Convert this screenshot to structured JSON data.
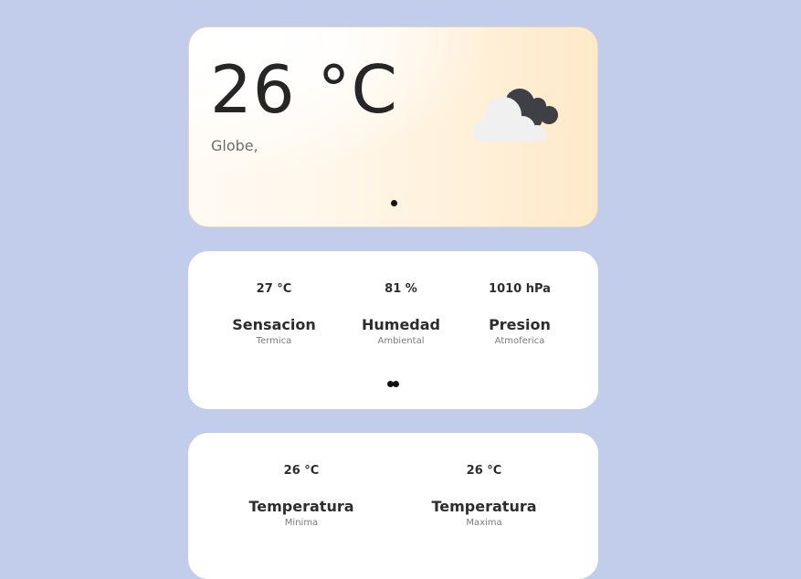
{
  "current": {
    "temperature": "26 °C",
    "location": "Globe,",
    "icon": "cloudy-icon"
  },
  "details": [
    {
      "value": "27 °C",
      "title": "Sensacion",
      "subtitle": "Termica"
    },
    {
      "value": "81 %",
      "title": "Humedad",
      "subtitle": "Ambiental"
    },
    {
      "value": "1010 hPa",
      "title": "Presion",
      "subtitle": "Atmoferica"
    }
  ],
  "minmax": [
    {
      "value": "26 °C",
      "title": "Temperatura",
      "subtitle": "Minima"
    },
    {
      "value": "26 °C",
      "title": "Temperatura",
      "subtitle": "Maxima"
    }
  ],
  "colors": {
    "background": "#c1cdea",
    "card": "#ffffff",
    "text": "#262626",
    "cloud_front": "#f0f0f0",
    "cloud_back": "#3f3f46"
  }
}
